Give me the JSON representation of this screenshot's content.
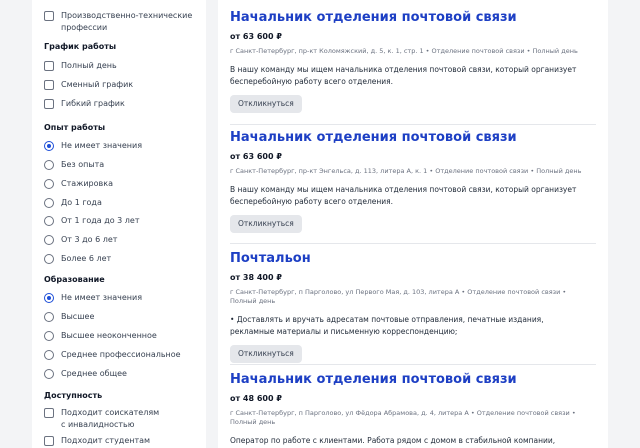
{
  "filters": {
    "top_item": {
      "line1": "Производственно-технические",
      "line2": "профессии"
    },
    "schedule": {
      "title": "График работы",
      "options": [
        "Полный день",
        "Сменный график",
        "Гибкий график"
      ]
    },
    "experience": {
      "title": "Опыт работы",
      "options": [
        "Не имеет значения",
        "Без опыта",
        "Стажировка",
        "До 1 года",
        "От 1 года до 3 лет",
        "От 3 до 6 лет",
        "Более 6 лет"
      ],
      "selected": 0
    },
    "education": {
      "title": "Образование",
      "options": [
        "Не имеет значения",
        "Высшее",
        "Высшее неоконченное",
        "Среднее профессиональное",
        "Среднее общее"
      ],
      "selected": 0
    },
    "accessibility": {
      "title": "Доступность",
      "options": [
        {
          "line1": "Подходит соискателям",
          "line2": "с инвалидностью"
        },
        {
          "line1": "Подходит студентам",
          "line2": ""
        }
      ]
    }
  },
  "vacancies": [
    {
      "title": "Начальник отделения почтовой связи",
      "salary": "от 63 600 ₽",
      "meta": "г Санкт-Петербург, пр-кт Коломяжский, д. 5, к. 1, стр. 1 • Отделение почтовой связи • Полный день",
      "description": "В нашу команду мы ищем начальника отделения почтовой связи, который организует бесперебойную работу всего отделения.",
      "button": "Откликнуться"
    },
    {
      "title": "Начальник отделения почтовой связи",
      "salary": "от 63 600 ₽",
      "meta": "г Санкт-Петербург, пр-кт Энгельса, д. 113, литера А, к. 1 • Отделение почтовой связи • Полный день",
      "description": "В нашу команду мы ищем начальника отделения почтовой связи, который организует бесперебойную работу всего отделения.",
      "button": "Откликнуться"
    },
    {
      "title": "Почтальон",
      "salary": "от 38 400 ₽",
      "meta": "г Санкт-Петербург, п Парголово, ул Первого Мая, д. 103, литера А • Отделение почтовой связи • Полный день",
      "description": "• Доставлять и вручать адресатам почтовые отправления, печатные издания, рекламные материалы и письменную корреспонденцию;",
      "button": "Откликнуться"
    },
    {
      "title": "Начальник отделения почтовой связи",
      "salary": "от 48 600 ₽",
      "meta": "г Санкт-Петербург, п Парголово, ул Фёдора Абрамова, д. 4, литера А • Отделение почтовой связи • Полный день",
      "description": "Оператор по работе с клиентами. Работа рядом с домом в стабильной компании, удобный график работы, влияйте на свой доход самостоятельно",
      "button": ""
    }
  ]
}
